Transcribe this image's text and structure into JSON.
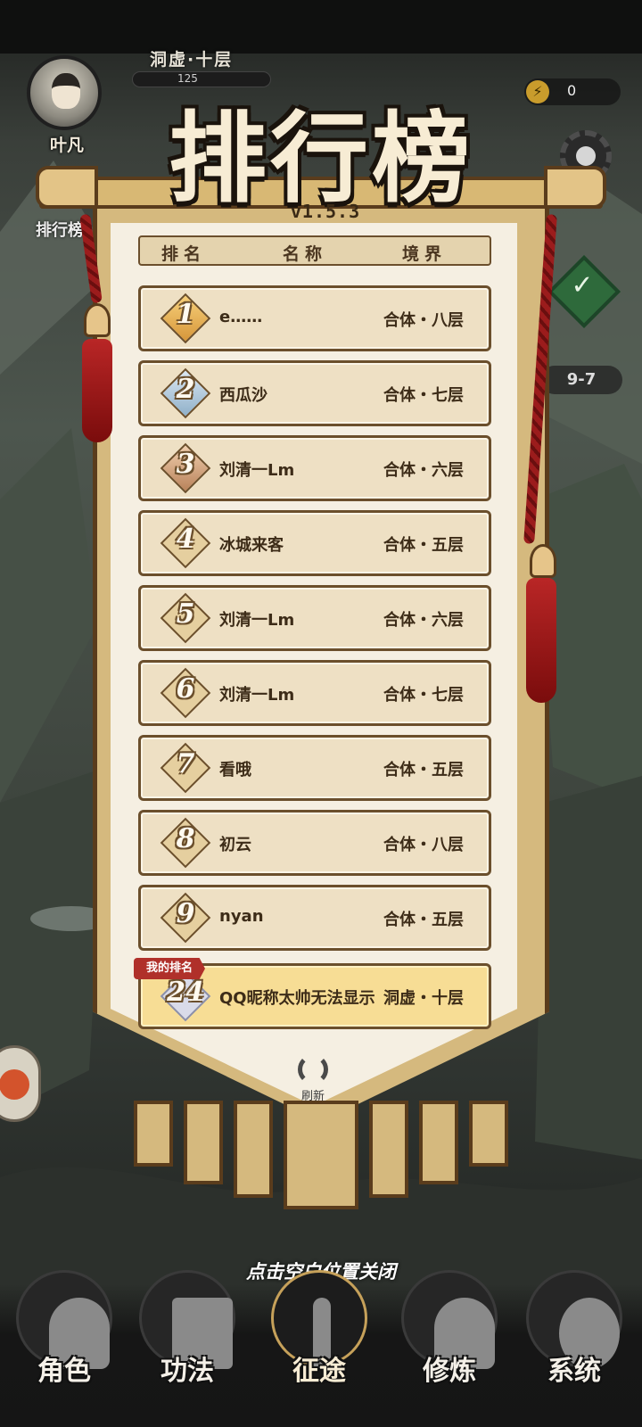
{
  "hud": {
    "player_name": "叶凡",
    "realm": "洞虚·十层",
    "exp_text": "125",
    "energy_value": "0",
    "side_label": "排行榜",
    "stage": "9-7",
    "icons": {
      "energy": "lightning-icon",
      "settings": "gear-icon",
      "quest": "checkmark-icon"
    }
  },
  "leaderboard": {
    "title": "排行榜",
    "version": "v1.5.3",
    "headers": {
      "rank": "排名",
      "name": "名称",
      "realm": "境界"
    },
    "rows": [
      {
        "rank": "1",
        "name": "e……",
        "realm": "合体・八层"
      },
      {
        "rank": "2",
        "name": "西瓜沙",
        "realm": "合体・七层"
      },
      {
        "rank": "3",
        "name": "刘清一Lm",
        "realm": "合体・六层"
      },
      {
        "rank": "4",
        "name": "冰城来客",
        "realm": "合体・五层"
      },
      {
        "rank": "5",
        "name": "刘清一Lm",
        "realm": "合体・六层"
      },
      {
        "rank": "6",
        "name": "刘清一Lm",
        "realm": "合体・七层"
      },
      {
        "rank": "7",
        "name": "看哦",
        "realm": "合体・五层"
      },
      {
        "rank": "8",
        "name": "初云",
        "realm": "合体・八层"
      },
      {
        "rank": "9",
        "name": "nyan",
        "realm": "合体・五层"
      }
    ],
    "my_rank": {
      "tag": "我的排名",
      "rank": "24",
      "name": "QQ昵称太帅无法显示",
      "realm": "洞虚・十层"
    },
    "refresh_label": "刷新"
  },
  "close_hint": "点击空白位置关闭",
  "nav": [
    {
      "label": "角色",
      "icon": "character-icon"
    },
    {
      "label": "功法",
      "icon": "book-icon"
    },
    {
      "label": "征途",
      "icon": "sword-icon",
      "active": true
    },
    {
      "label": "修炼",
      "icon": "meditation-icon"
    },
    {
      "label": "系统",
      "icon": "system-icon"
    }
  ],
  "colors": {
    "parchment": "#f5efe2",
    "row_bg": "#eee0c4",
    "my_row_bg": "#f7dd95",
    "border_brown": "#6b4f2c",
    "tassel_red": "#9b1c1c",
    "tag_red": "#b0302a"
  }
}
